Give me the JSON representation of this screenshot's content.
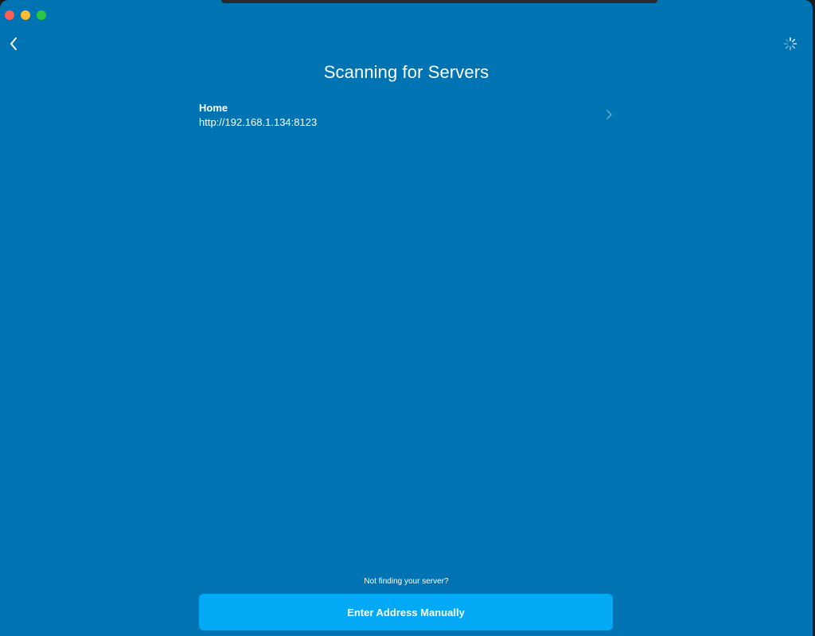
{
  "window": {
    "background": "#0073b2"
  },
  "header": {
    "title": "Scanning for Servers",
    "back_icon": "chevron-left-icon",
    "activity_icon": "spinner-icon"
  },
  "servers": [
    {
      "name": "Home",
      "url": "http://192.168.1.134:8123",
      "icon": "chevron-right-icon"
    }
  ],
  "footer": {
    "hint": "Not finding your server?",
    "manual_button_label": "Enter Address Manually",
    "button_color": "#03a9f4"
  }
}
